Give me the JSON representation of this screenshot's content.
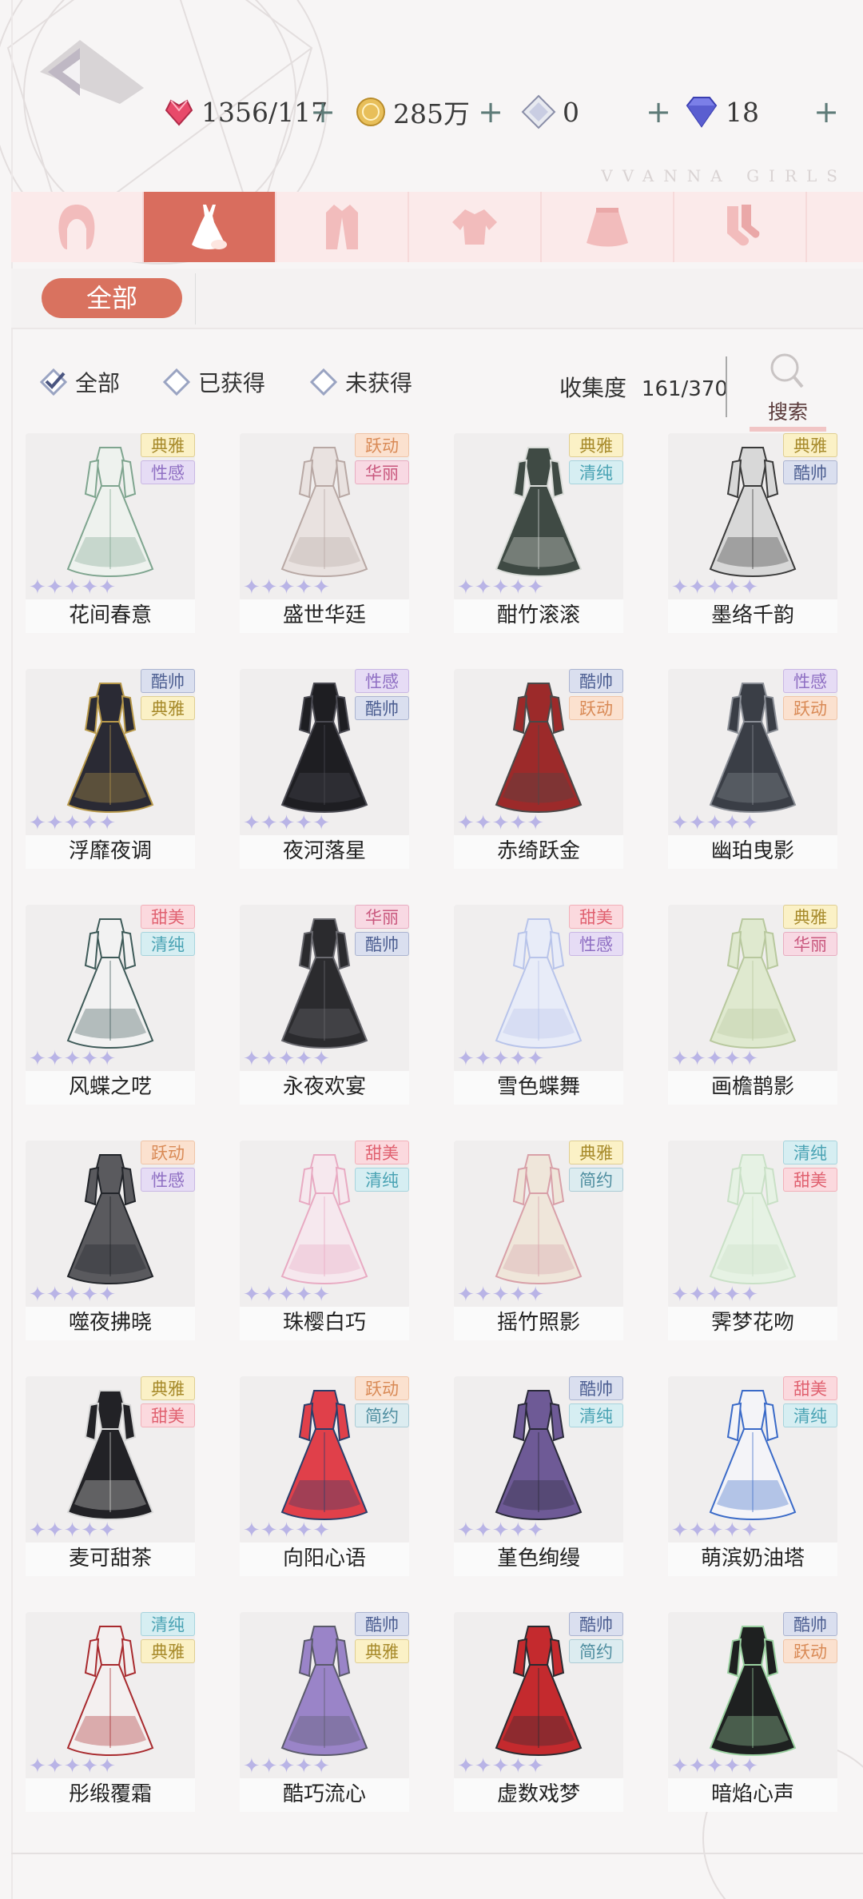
{
  "currency": {
    "stamina": "1356/117",
    "coins": "285万",
    "crystal": "0",
    "diamond": "18"
  },
  "brand": "VVANNA GIRLS",
  "category_tabs": [
    {
      "icon": "hair-icon",
      "active": false
    },
    {
      "icon": "dress-icon",
      "active": true
    },
    {
      "icon": "coat-icon",
      "active": false
    },
    {
      "icon": "top-icon",
      "active": false
    },
    {
      "icon": "skirt-icon",
      "active": false
    },
    {
      "icon": "socks-icon",
      "active": false
    }
  ],
  "sub_filter": {
    "label": "全部"
  },
  "filters": {
    "all": "全部",
    "owned": "已获得",
    "not_owned": "未获得"
  },
  "collection": {
    "label": "收集度",
    "value": "161/370"
  },
  "search": {
    "label": "搜索"
  },
  "tag_colors": {
    "典雅": {
      "bg": "#fbf1c6",
      "fg": "#a78a2a"
    },
    "性感": {
      "bg": "#e6dcf5",
      "fg": "#8f6fc3"
    },
    "跃动": {
      "bg": "#fbe1cf",
      "fg": "#d98a56"
    },
    "华丽": {
      "bg": "#f8d9e3",
      "fg": "#c9587e"
    },
    "清纯": {
      "bg": "#d6eef2",
      "fg": "#4aa3b4"
    },
    "酷帅": {
      "bg": "#dadfef",
      "fg": "#4d5f92"
    },
    "甜美": {
      "bg": "#fbd9de",
      "fg": "#e0606f"
    },
    "简约": {
      "bg": "#dcecf0",
      "fg": "#4f8ea0"
    }
  },
  "outfits": [
    {
      "name": "花间春意",
      "tags": [
        "典雅",
        "性感"
      ],
      "palette": [
        "#eef2ee",
        "#7fa58f"
      ]
    },
    {
      "name": "盛世华廷",
      "tags": [
        "跃动",
        "华丽"
      ],
      "palette": [
        "#e9e2e0",
        "#b8a8a4"
      ]
    },
    {
      "name": "酣竹滚滚",
      "tags": [
        "典雅",
        "清纯"
      ],
      "palette": [
        "#3f4a44",
        "#d9dcd8"
      ]
    },
    {
      "name": "墨络千韵",
      "tags": [
        "典雅",
        "酷帅"
      ],
      "palette": [
        "#d8d8d8",
        "#3a3a3a"
      ]
    },
    {
      "name": "浮靡夜调",
      "tags": [
        "酷帅",
        "典雅"
      ],
      "palette": [
        "#2a2a34",
        "#b8994a"
      ]
    },
    {
      "name": "夜河落星",
      "tags": [
        "性感",
        "酷帅"
      ],
      "palette": [
        "#1e1e22",
        "#4a4a52"
      ]
    },
    {
      "name": "赤绮跃金",
      "tags": [
        "酷帅",
        "跃动"
      ],
      "palette": [
        "#9c2a2a",
        "#4a4848"
      ]
    },
    {
      "name": "幽珀曳影",
      "tags": [
        "性感",
        "跃动"
      ],
      "palette": [
        "#3a3e46",
        "#8a8e96"
      ]
    },
    {
      "name": "风蝶之呓",
      "tags": [
        "甜美",
        "清纯"
      ],
      "palette": [
        "#f2f2f2",
        "#3e5a58"
      ]
    },
    {
      "name": "永夜欢宴",
      "tags": [
        "华丽",
        "酷帅"
      ],
      "palette": [
        "#2b2b2e",
        "#6a6a70"
      ]
    },
    {
      "name": "雪色蝶舞",
      "tags": [
        "甜美",
        "性感"
      ],
      "palette": [
        "#e8ecf8",
        "#b8c4ea"
      ]
    },
    {
      "name": "画檐鹊影",
      "tags": [
        "典雅",
        "华丽"
      ],
      "palette": [
        "#dfe9cf",
        "#b8c89e"
      ]
    },
    {
      "name": "噬夜拂晓",
      "tags": [
        "跃动",
        "性感"
      ],
      "palette": [
        "#5a5a5e",
        "#22252a"
      ]
    },
    {
      "name": "珠樱白巧",
      "tags": [
        "甜美",
        "清纯"
      ],
      "palette": [
        "#f6e8ee",
        "#e8aac2"
      ]
    },
    {
      "name": "摇竹照影",
      "tags": [
        "典雅",
        "简约"
      ],
      "palette": [
        "#efe6da",
        "#d8a0a8"
      ]
    },
    {
      "name": "霁梦花吻",
      "tags": [
        "清纯",
        "甜美"
      ],
      "palette": [
        "#e6f2e4",
        "#c9e0c6"
      ]
    },
    {
      "name": "麦可甜茶",
      "tags": [
        "典雅",
        "甜美"
      ],
      "palette": [
        "#222226",
        "#d8d8d8"
      ]
    },
    {
      "name": "向阳心语",
      "tags": [
        "跃动",
        "简约"
      ],
      "palette": [
        "#e0404a",
        "#2a3e6a"
      ]
    },
    {
      "name": "堇色绚缦",
      "tags": [
        "酷帅",
        "清纯"
      ],
      "palette": [
        "#6e5a96",
        "#2a2a3a"
      ]
    },
    {
      "name": "萌滨奶油塔",
      "tags": [
        "甜美",
        "清纯"
      ],
      "palette": [
        "#f4f4f8",
        "#3a6ac8"
      ]
    },
    {
      "name": "彤缎覆霜",
      "tags": [
        "清纯",
        "典雅"
      ],
      "palette": [
        "#f4f0f0",
        "#a82a2e"
      ]
    },
    {
      "name": "酷巧流心",
      "tags": [
        "酷帅",
        "典雅"
      ],
      "palette": [
        "#9a84c8",
        "#5a5a6a"
      ]
    },
    {
      "name": "虚数戏梦",
      "tags": [
        "酷帅",
        "简约"
      ],
      "palette": [
        "#c42a2e",
        "#2a2a30"
      ]
    },
    {
      "name": "暗焰心声",
      "tags": [
        "酷帅",
        "跃动"
      ],
      "palette": [
        "#1e2020",
        "#9ad0a0"
      ]
    }
  ]
}
